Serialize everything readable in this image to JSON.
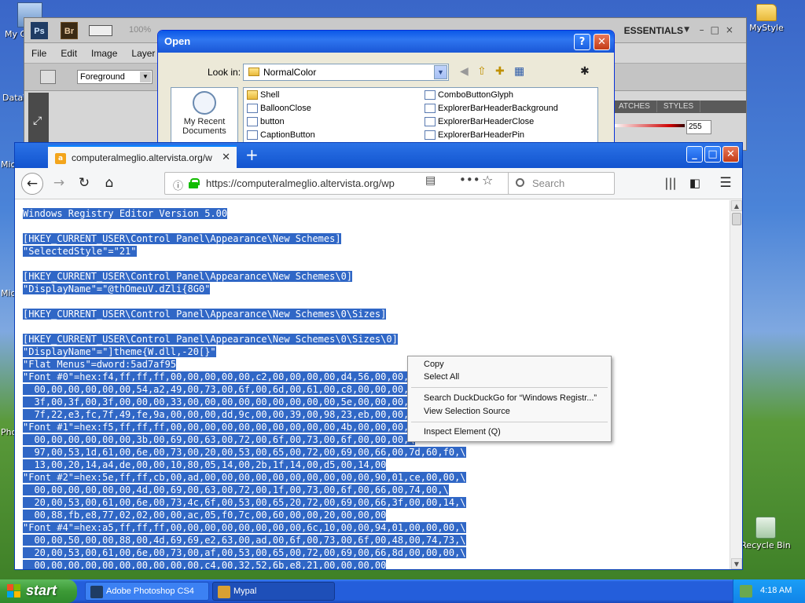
{
  "desktop": {
    "icons": [
      {
        "label": "My C"
      },
      {
        "label": "DataV"
      },
      {
        "label": "MyStyle"
      },
      {
        "label": "Recycle Bin"
      }
    ],
    "edge_labels": [
      "Mic",
      "Mic",
      "Pho"
    ]
  },
  "photoshop": {
    "logo": "Ps",
    "bridge_logo": "Br",
    "zoom": "100%",
    "workspace": "ESSENTIALS",
    "menus": [
      "File",
      "Edit",
      "Image",
      "Layer"
    ],
    "foreground_select": "Foreground",
    "panel_tabs": [
      "ATCHES",
      "STYLES"
    ],
    "value": "255"
  },
  "open_dialog": {
    "title": "Open",
    "look_in_label": "Look in:",
    "look_in_value": "NormalColor",
    "places": [
      {
        "label": "My Recent Documents"
      }
    ],
    "files": [
      {
        "name": "Shell",
        "type": "folder"
      },
      {
        "name": "BalloonClose",
        "type": "image"
      },
      {
        "name": "button",
        "type": "image"
      },
      {
        "name": "CaptionButton",
        "type": "image"
      },
      {
        "name": "ComboButtonGlyph",
        "type": "image"
      },
      {
        "name": "ExplorerBarHeaderBackground",
        "type": "image"
      },
      {
        "name": "ExplorerBarHeaderClose",
        "type": "image"
      },
      {
        "name": "ExplorerBarHeaderPin",
        "type": "image"
      }
    ]
  },
  "firefox": {
    "tab_title": "computeralmeglio.altervista.org/w",
    "url": "https://computeralmeglio.altervista.org/wp",
    "search_placeholder": "Search",
    "content_lines": [
      "Windows Registry Editor Version 5.00",
      "",
      "[HKEY_CURRENT_USER\\Control Panel\\Appearance\\New Schemes]",
      "\"SelectedStyle\"=\"21\"",
      "",
      "[HKEY_CURRENT_USER\\Control Panel\\Appearance\\New Schemes\\0]",
      "\"DisplayName\"=\"@thOmeuV.dZli{8G0\"",
      "",
      "[HKEY_CURRENT_USER\\Control Panel\\Appearance\\New Schemes\\0\\Sizes]",
      "",
      "[HKEY_CURRENT_USER\\Control Panel\\Appearance\\New Schemes\\0\\Sizes\\0]",
      "\"DisplayName\"=\"]theme{W.dll,-20[}\"",
      "\"Flat Menus\"=dword:5ad7af95",
      "\"Font #0\"=hex:f4,ff,ff,ff,00,00,00,00,00,c2,00,00,00,00,d4,56,00,00,00,\\",
      "  00,00,00,00,00,00,54,a2,49,00,73,00,6f,00,6d,00,61,00,c8,00,00,00,\\",
      "  3f,00,3f,00,3f,00,00,00,33,00,00,00,00,00,00,00,00,00,5e,00,00,00,\\",
      "  7f,22,e3,fc,7f,49,fe,9a,00,00,00,dd,9c,00,00,39,00,98,23,eb,00,00,\\",
      "\"Font #1\"=hex:f5,ff,ff,ff,00,00,00,00,00,00,00,00,00,00,4b,00,00,00,00,\\",
      "  00,00,00,00,00,00,3b,00,69,00,63,00,72,00,6f,00,73,00,6f,00,00,00,\\",
      "  97,00,53,1d,61,00,6e,00,73,00,20,00,53,00,65,00,72,00,69,00,66,00,7d,60,f0,\\",
      "  13,00,20,14,a4,de,00,00,10,80,05,14,00,2b,1f,14,00,d5,00,14,00",
      "\"Font #2\"=hex:5e,ff,ff,cb,00,ad,00,00,00,00,00,00,00,00,00,00,90,01,ce,00,00,\\",
      "  00,00,00,00,00,00,4d,00,69,00,63,00,72,00,1f,00,73,00,6f,00,66,00,74,00,\\",
      "  20,00,53,00,61,00,6e,00,73,4c,6f,00,53,00,65,20,72,00,69,00,66,3f,00,00,14,\\",
      "  00,88,fb,e8,77,02,02,00,00,ac,05,f0,7c,00,60,00,00,20,00,00,00",
      "\"Font #4\"=hex:a5,ff,ff,ff,00,00,00,00,00,00,00,00,6c,10,00,00,94,01,00,00,00,\\",
      "  00,00,50,00,00,88,00,4d,69,69,e2,63,00,ad,00,6f,00,73,00,6f,00,48,00,74,73,\\",
      "  20,00,53,00,61,00,6e,00,73,00,af,00,53,00,65,00,72,00,69,00,66,8d,00,00,00,\\",
      "  00,00,00,00,00,00,00,00,00,00,c4,00,32,52,6b,e8,21,00,00,00,00"
    ]
  },
  "context_menu": {
    "items": [
      {
        "label": "Copy"
      },
      {
        "label": "Select All"
      },
      {
        "label": "Search DuckDuckGo for “Windows Registr...”"
      },
      {
        "label": "View Selection Source"
      },
      {
        "label": "Inspect Element (Q)"
      }
    ]
  },
  "taskbar": {
    "start_label": "start",
    "tasks": [
      {
        "label": "Adobe Photoshop CS4"
      },
      {
        "label": "Mypal"
      }
    ],
    "clock": "4:18 AM"
  },
  "colors": {
    "selection": "#3067c6",
    "xp_title": "#0a58e8",
    "taskbar": "#245edb",
    "start_green": "#3c9a36"
  }
}
